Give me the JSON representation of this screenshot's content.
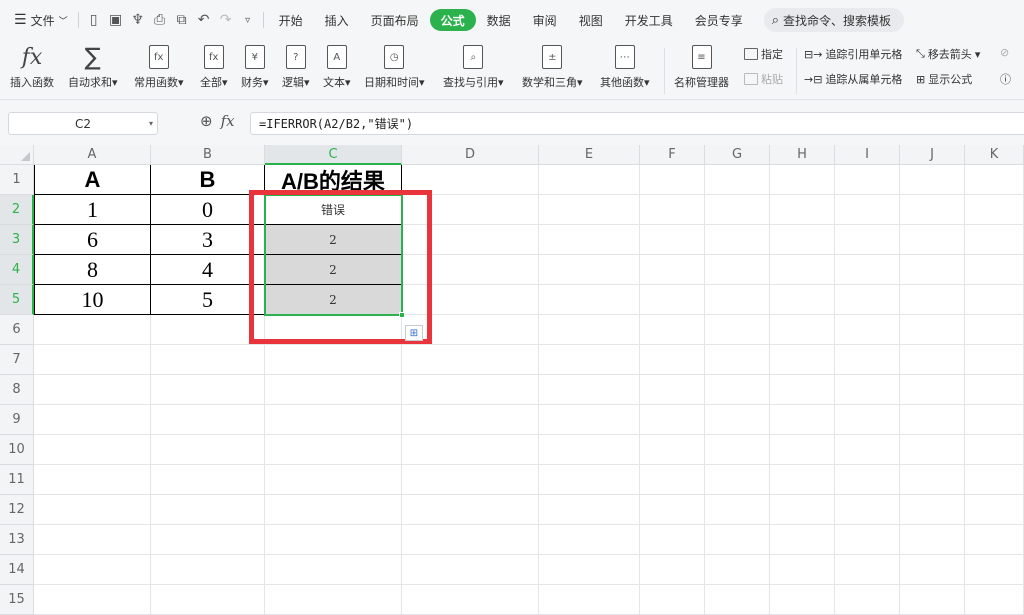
{
  "menubar": {
    "file_label": "文件",
    "tabs": [
      "开始",
      "插入",
      "页面布局",
      "公式",
      "数据",
      "审阅",
      "视图",
      "开发工具",
      "会员专享"
    ],
    "active_tab": "公式",
    "search_text": "查找命令、搜索模板"
  },
  "ribbon": {
    "buttons": [
      {
        "label": "插入函数",
        "icon": "fx-icon"
      },
      {
        "label": "自动求和",
        "icon": "sigma-icon"
      },
      {
        "label": "常用函数",
        "icon": "star-function-icon"
      },
      {
        "label": "全部",
        "icon": "fx-doc-icon"
      },
      {
        "label": "财务",
        "icon": "yen-icon"
      },
      {
        "label": "逻辑",
        "icon": "question-icon"
      },
      {
        "label": "文本",
        "icon": "text-a-icon"
      },
      {
        "label": "日期和时间",
        "icon": "clock-icon"
      },
      {
        "label": "查找与引用",
        "icon": "magnifier-doc-icon"
      },
      {
        "label": "数学和三角",
        "icon": "math-icon"
      },
      {
        "label": "其他函数",
        "icon": "dots-doc-icon"
      },
      {
        "label": "名称管理器",
        "icon": "name-manager-icon"
      }
    ],
    "small": {
      "specify": "指定",
      "paste": "粘贴",
      "trace_precedents": "追踪引用单元格",
      "trace_dependents": "追踪从属单元格",
      "remove_arrows": "移去箭头",
      "show_formulas": "显示公式"
    }
  },
  "formula_bar": {
    "name_box": "C2",
    "formula": "=IFERROR(A2/B2,\"错误\")"
  },
  "grid": {
    "columns": [
      "A",
      "B",
      "C",
      "D",
      "E",
      "F",
      "G",
      "H",
      "I",
      "J",
      "K"
    ],
    "rows": [
      "1",
      "2",
      "3",
      "4",
      "5",
      "6",
      "7",
      "8",
      "9",
      "10",
      "11",
      "12",
      "13",
      "14",
      "15"
    ],
    "headers": {
      "a": "A",
      "b": "B",
      "c": "A/B的结果"
    },
    "data": [
      {
        "a": "1",
        "b": "0",
        "c": "错误"
      },
      {
        "a": "6",
        "b": "3",
        "c": "2"
      },
      {
        "a": "8",
        "b": "4",
        "c": "2"
      },
      {
        "a": "10",
        "b": "5",
        "c": "2"
      }
    ]
  },
  "colors": {
    "accent": "#2bb24c",
    "highlight_box": "#e8343a",
    "selected_fill": "#d9d9d9"
  }
}
